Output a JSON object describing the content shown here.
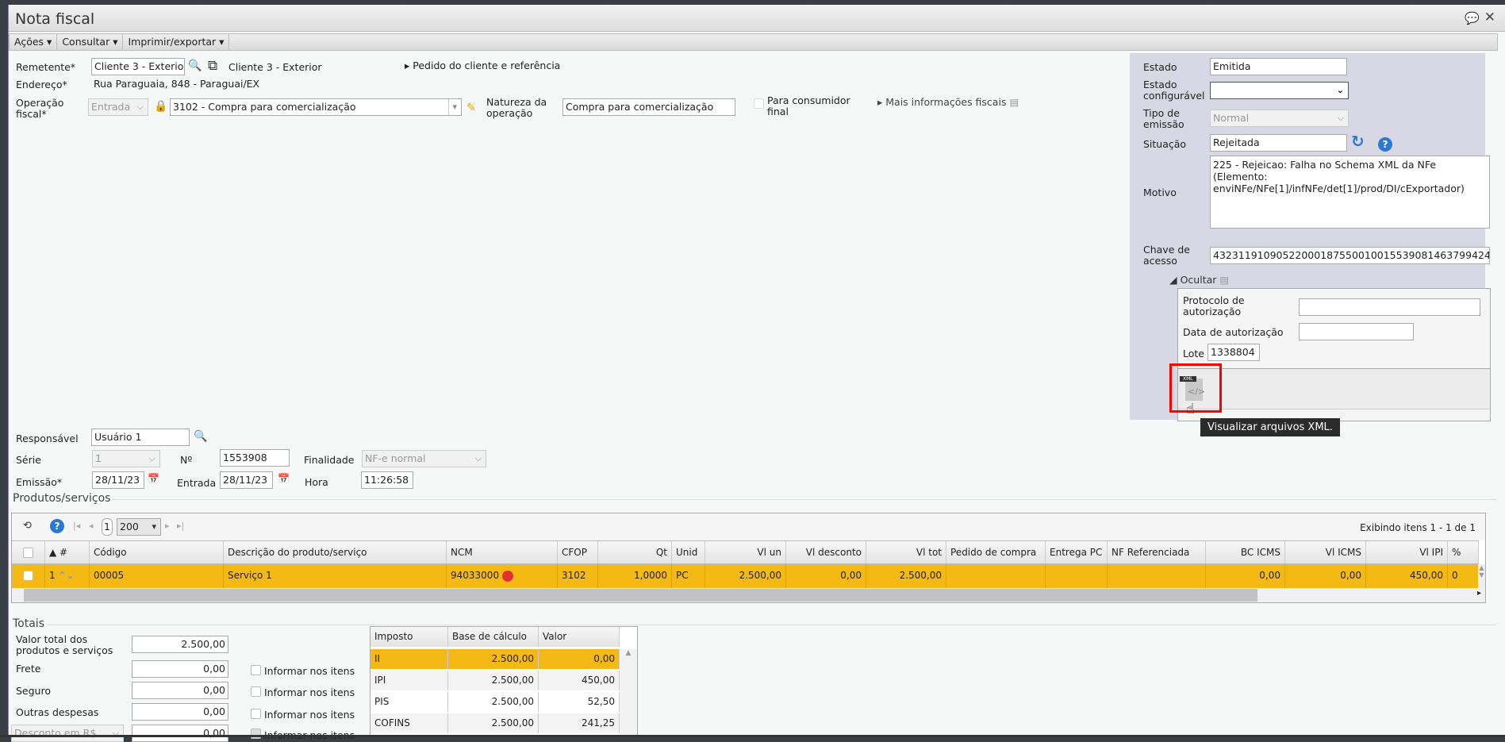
{
  "window": {
    "title": "Nota fiscal"
  },
  "toolbar": {
    "acoes": "Ações ▾",
    "consultar": "Consultar ▾",
    "imprimir": "Imprimir/exportar ▾"
  },
  "form": {
    "remetente_label": "Remetente*",
    "remetente_value": "Cliente 3 - Exterior",
    "remetente_link": "Cliente 3 - Exterior",
    "pedido_link": "Pedido do cliente e referência",
    "endereco_label": "Endereço*",
    "endereco_value": "Rua Paraguaia, 848 - Paraguai/EX",
    "operacao_label": "Operação fiscal*",
    "operacao_tipo": "Entrada",
    "operacao_value": "3102 - Compra para comercialização",
    "natureza_label": "Natureza da operação",
    "natureza_value": "Compra para comercialização",
    "consumidor_label": "Para consumidor final",
    "mais_info": "Mais informações fiscais",
    "responsavel_label": "Responsável",
    "responsavel_value": "Usuário 1",
    "serie_label": "Série",
    "serie_value": "1",
    "numero_label": "Nº",
    "numero_value": "1553908",
    "finalidade_label": "Finalidade",
    "finalidade_value": "NF-e normal",
    "emissao_label": "Emissão*",
    "emissao_value": "28/11/23",
    "entrada_label": "Entrada",
    "entrada_value": "28/11/23",
    "hora_label": "Hora",
    "hora_value": "11:26:58"
  },
  "status_panel": {
    "estado_label": "Estado",
    "estado_value": "Emitida",
    "estado_conf_label": "Estado configurável",
    "estado_conf_value": "",
    "tipo_label": "Tipo de emissão",
    "tipo_value": "Normal",
    "situacao_label": "Situação",
    "situacao_value": "Rejeitada",
    "motivo_label": "Motivo",
    "motivo_value": "225 - Rejeicao: Falha no Schema XML da NFe (Elemento: enviNFe/NFe[1]/infNFe/det[1]/prod/DI/cExportador)",
    "chave_label": "Chave de acesso",
    "chave_value": "43231191090522000187550010015539081463799424",
    "ocultar": "Ocultar",
    "protocolo_label": "Protocolo de autorização",
    "protocolo_value": "",
    "data_aut_label": "Data de autorização",
    "data_aut_value": "",
    "lote_label": "Lote",
    "lote_value": "1338804",
    "xml_badge": "XML",
    "tooltip": "Visualizar arquivos XML."
  },
  "products": {
    "section_title": "Produtos/serviços",
    "page": "1",
    "page_size": "200",
    "showing": "Exibindo itens 1 - 1 de 1",
    "columns": [
      "",
      "▲ #",
      "Código",
      "Descrição do produto/serviço",
      "NCM",
      "CFOP",
      "Qt",
      "Unid",
      "Vl un",
      "Vl desconto",
      "Vl tot",
      "Pedido de compra",
      "Entrega PC",
      "NF Referenciada",
      "BC ICMS",
      "Vl ICMS",
      "Vl IPI",
      "%"
    ],
    "rows": [
      [
        "",
        "1",
        "00005",
        "Serviço 1",
        "94033000",
        "3102",
        "1,0000",
        "PC",
        "2.500,00",
        "0,00",
        "2.500,00",
        "",
        "",
        "",
        "0,00",
        "0,00",
        "450,00",
        "0"
      ]
    ]
  },
  "totals": {
    "section_title": "Totais",
    "valor_total_label": "Valor total dos produtos e serviços",
    "valor_total_value": "2.500,00",
    "frete_label": "Frete",
    "frete_value": "0,00",
    "seguro_label": "Seguro",
    "seguro_value": "0,00",
    "outras_label": "Outras despesas",
    "outras_value": "0,00",
    "desconto_label": "Desconto em R$",
    "desconto_value": "0,00",
    "informar": "Informar nos itens",
    "tax_columns": [
      "Imposto",
      "Base de cálculo",
      "Valor"
    ],
    "tax_rows": [
      [
        "II",
        "2.500,00",
        "0,00"
      ],
      [
        "IPI",
        "2.500,00",
        "450,00"
      ],
      [
        "PIS",
        "2.500,00",
        "52,50"
      ],
      [
        "COFINS",
        "2.500,00",
        "241,25"
      ]
    ]
  },
  "colors": {
    "selected_row": "#f5b915",
    "panel": "#d8d8e4",
    "highlight_box": "#ff0000"
  }
}
